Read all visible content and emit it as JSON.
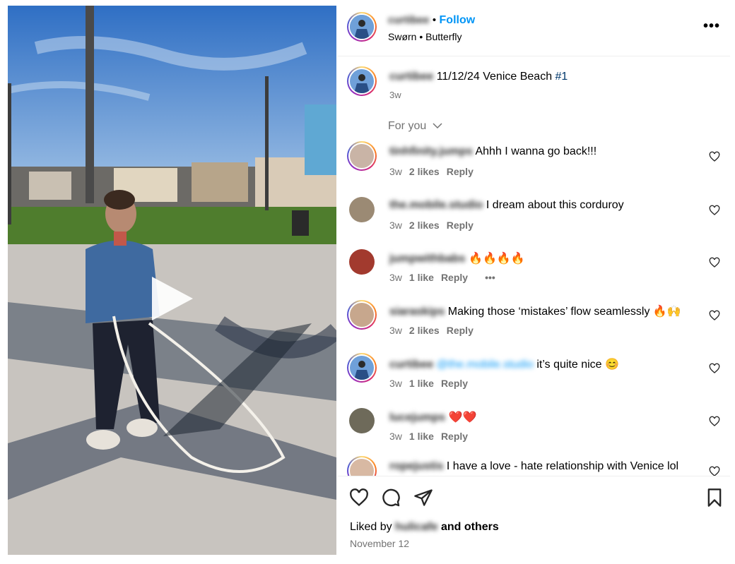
{
  "post": {
    "author": "curtibee",
    "follow_label": "Follow",
    "separator": "•",
    "music": "Swørn • Butterfly",
    "more_label": "•••"
  },
  "caption": {
    "user": "curtibee",
    "text": " 11/12/24 Venice Beach ",
    "hashtag": "#1",
    "time": "3w"
  },
  "sort": {
    "label": "For you"
  },
  "comments": [
    {
      "user": "tinhfinity.jumps",
      "text": "Ahhh I wanna go back!!!",
      "time": "3w",
      "likes": "2 likes",
      "reply": "Reply",
      "avatar_color": "#c9b4a6"
    },
    {
      "user": "the.mobile.studio",
      "text": "I dream about this corduroy",
      "time": "3w",
      "likes": "2 likes",
      "reply": "Reply",
      "avatar_color": "#9b8a74"
    },
    {
      "user": "jumpwithbabs",
      "text": "🔥🔥🔥🔥",
      "time": "3w",
      "likes": "1 like",
      "reply": "Reply",
      "extra": "•••",
      "avatar_color": "#a23a2e"
    },
    {
      "user": "siaraskips",
      "text": "Making those ‘mistakes’ flow seamlessly 🔥🙌",
      "time": "3w",
      "likes": "2 likes",
      "reply": "Reply",
      "avatar_color": "#c7a78d"
    },
    {
      "user": "curtibee",
      "mention": "@the.mobile.studio",
      "text": " it’s quite nice 😊",
      "time": "3w",
      "likes": "1 like",
      "reply": "Reply",
      "avatar_color": "#4f7fb8"
    },
    {
      "user": "lucejumps",
      "text": "❤️❤️",
      "time": "3w",
      "likes": "1 like",
      "reply": "Reply",
      "avatar_color": "#6e6a5a"
    },
    {
      "user": "ropejustis",
      "text": " I have a love - hate relationship with Venice lol",
      "time": "",
      "likes": "",
      "reply": "",
      "avatar_color": "#d8b9a3"
    }
  ],
  "footer": {
    "liked_prefix": "Liked by ",
    "liked_user": "hulicafe",
    "liked_suffix": " and others",
    "date": "November 12"
  },
  "colors": {
    "link_blue": "#0095f6",
    "hashtag": "#00376b",
    "secondary": "#737373",
    "divider": "#efefef"
  }
}
